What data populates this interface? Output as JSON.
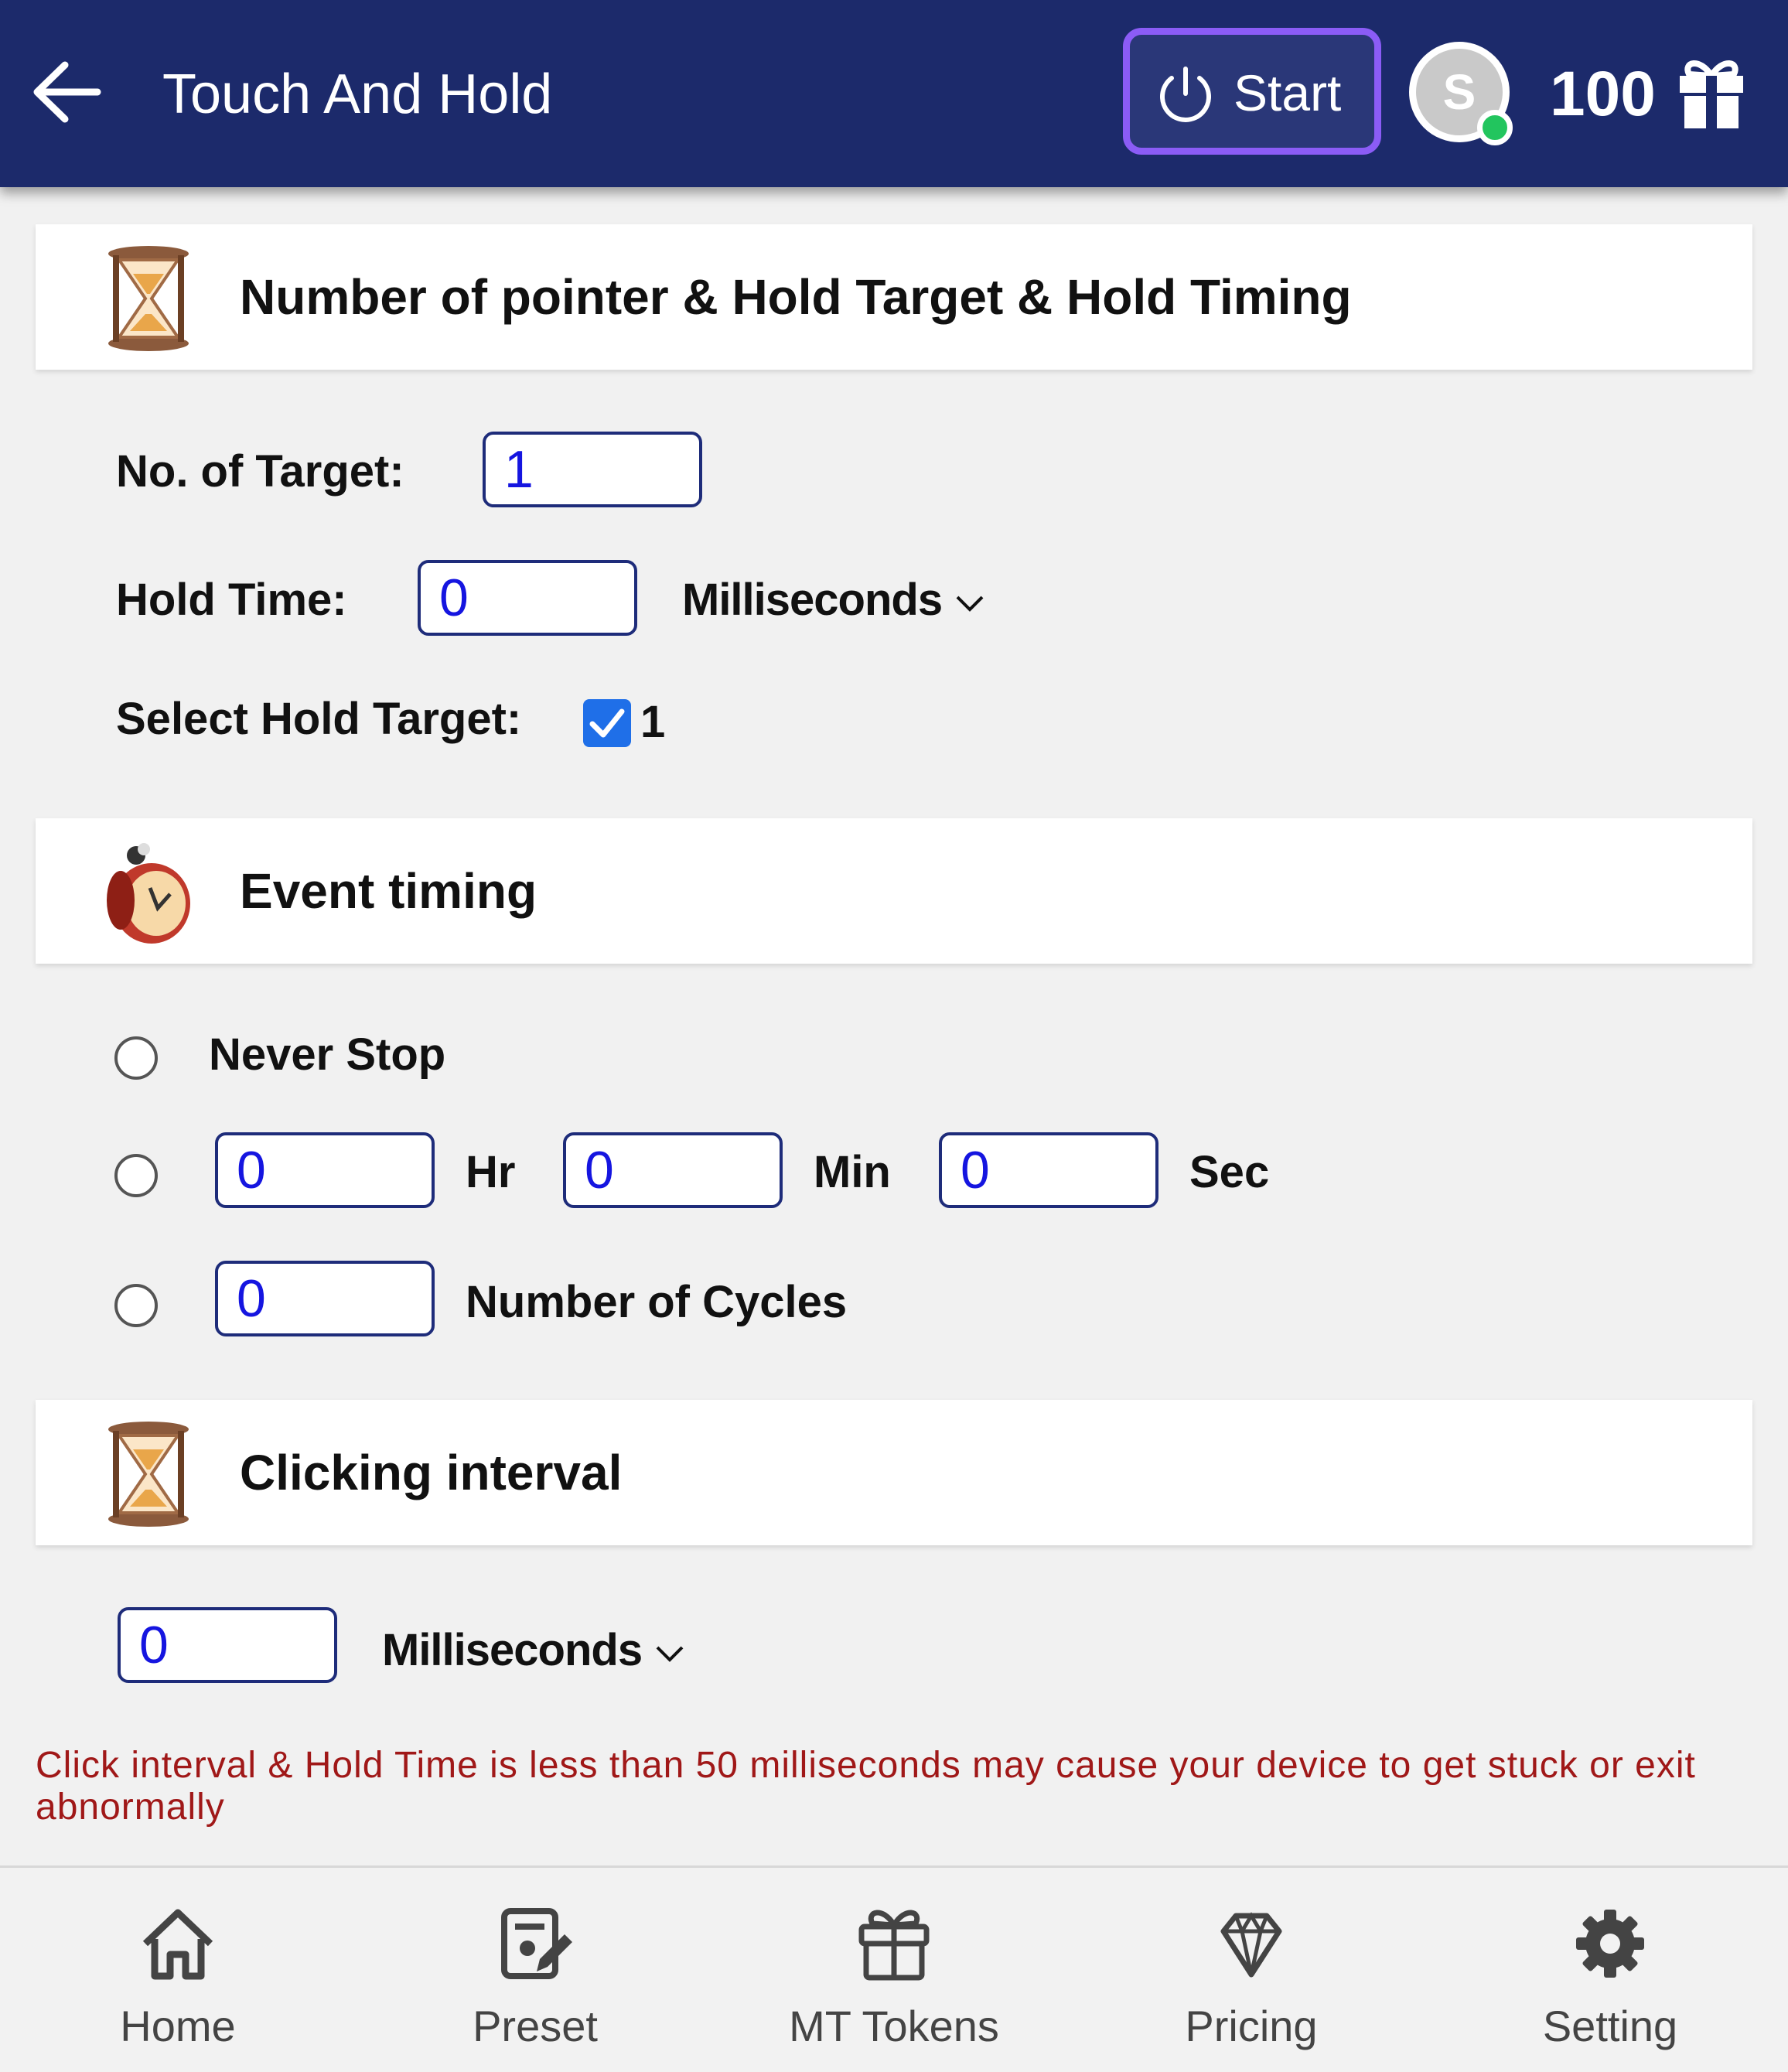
{
  "header": {
    "title": "Touch And Hold",
    "start_label": "Start",
    "avatar_letter": "S",
    "points": "100"
  },
  "sections": {
    "pointer": {
      "title": "Number of pointer & Hold Target & Hold Timing"
    },
    "event_timing": {
      "title": "Event timing"
    },
    "clicking_interval": {
      "title": "Clicking interval"
    }
  },
  "pointer_settings": {
    "targets_label": "No. of Target:",
    "targets_value": "1",
    "hold_time_label": "Hold Time:",
    "hold_time_value": "0",
    "hold_time_unit": "Milliseconds",
    "select_target_label": "Select Hold Target:",
    "selected_target": "1"
  },
  "event_timing": {
    "never_stop_label": "Never Stop",
    "hr_value": "0",
    "hr_label": "Hr",
    "min_value": "0",
    "min_label": "Min",
    "sec_value": "0",
    "sec_label": "Sec",
    "cycles_value": "0",
    "cycles_label": "Number of Cycles"
  },
  "clicking_interval": {
    "value": "0",
    "unit": "Milliseconds"
  },
  "warning": "Click interval & Hold Time is less than 50 milliseconds may cause your device to get stuck or exit abnormally",
  "nav": {
    "home": "Home",
    "preset": "Preset",
    "mt_tokens": "MT Tokens",
    "pricing": "Pricing",
    "setting": "Setting"
  },
  "colors": {
    "header_bg": "#1c2a6b",
    "start_border": "#8b5cf6",
    "online": "#22c55e",
    "input_text": "#1515e0",
    "warning": "#a01818",
    "checkbox": "#1f6fe8"
  }
}
